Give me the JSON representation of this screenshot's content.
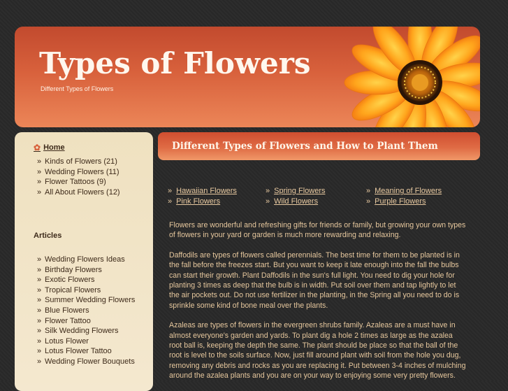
{
  "header": {
    "title": "Types of Flowers",
    "subtitle": "Different Types of Flowers"
  },
  "sidebar": {
    "home_label": "Home",
    "categories": [
      "Kinds of Flowers (21)",
      "Wedding Flowers (11)",
      "Flower Tattoos (9)",
      "All About Flowers (12)"
    ],
    "articles_heading": "Articles",
    "articles": [
      "Wedding Flowers Ideas",
      "Birthday Flowers",
      "Exotic Flowers",
      "Tropical Flowers",
      "Summer Wedding Flowers",
      "Blue Flowers",
      "Flower Tattoo",
      "Silk Wedding Flowers",
      "Lotus Flower",
      "Lotus Flower Tattoo",
      "Wedding Flower Bouquets"
    ]
  },
  "main": {
    "heading": "Different Types of Flowers and How to Plant Them",
    "links": [
      "Hawaiian Flowers",
      "Spring Flowers",
      "Meaning of Flowers",
      "Pink Flowers",
      "Wild Flowers",
      "Purple Flowers"
    ],
    "paragraphs": [
      "Flowers are wonderful and refreshing gifts for friends or family, but growing your own types of flowers in your yard or garden is much more rewarding and relaxing.",
      "Daffodils are types of flowers called perennials. The best time for them to be planted is in the fall before the freezes start. But you want to keep it late enough into the fall the bulbs can start their growth. Plant Daffodils in the sun's full light. You need to dig your hole for planting 3 times as deep that the bulb is in width. Put soil over them and tap lightly to let the air pockets out. Do not use fertilizer in the planting, in the Spring all you need to do is sprinkle some kind of bone meal over the plants.",
      "Azaleas are types of flowers in the evergreen shrubs family. Azaleas are a must have in almost everyone's garden and yards. To plant dig a hole 2 times as large as the azalea root ball is, keeping the depth the same. The plant should be place so that the ball of the root is level to the soils surface. Now, just fill around plant with soil from the hole you dug, removing any debris and rocks as you are replacing it. Put between 3-4 inches of mulching around the azalea plants and you are on your way to enjoying some very pretty flowers."
    ]
  },
  "colors": {
    "header_orange": "#d8613c",
    "sidebar_bg": "#efe1c0",
    "body_text": "#e6c79d",
    "page_bg": "#2a2a2a"
  },
  "icons": {
    "home": "flower-icon",
    "bullet": "double-chevron-right-icon"
  }
}
